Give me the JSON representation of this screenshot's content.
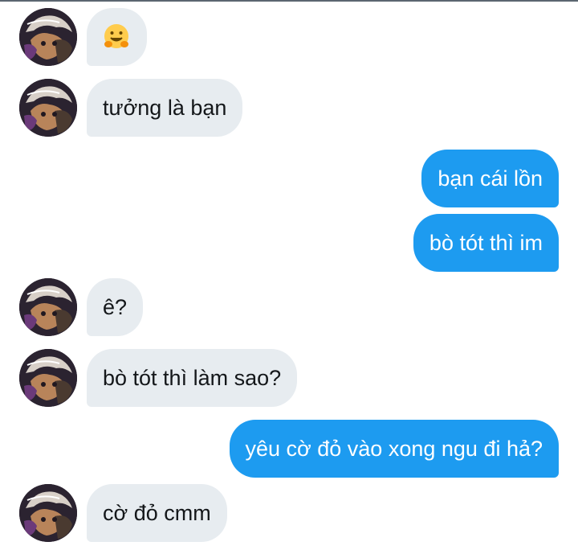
{
  "conversation": {
    "messages": [
      {
        "direction": "incoming",
        "icon": "hugging-face-emoji",
        "text": ""
      },
      {
        "direction": "incoming",
        "text": "tưởng là bạn"
      },
      {
        "direction": "outgoing",
        "text": "bạn cái lồn"
      },
      {
        "direction": "outgoing",
        "text": "bò tót thì im"
      },
      {
        "direction": "incoming",
        "text": "ê?"
      },
      {
        "direction": "incoming",
        "text": "bò tót thì làm sao?"
      },
      {
        "direction": "outgoing",
        "text": "yêu cờ đỏ vào xong ngu đi hả?"
      },
      {
        "direction": "incoming",
        "text": "cờ đỏ cmm"
      }
    ]
  },
  "colors": {
    "incoming_bubble": "#e7ecf0",
    "outgoing_bubble": "#1d9bf0",
    "incoming_text": "#14171a",
    "outgoing_text": "#ffffff"
  }
}
